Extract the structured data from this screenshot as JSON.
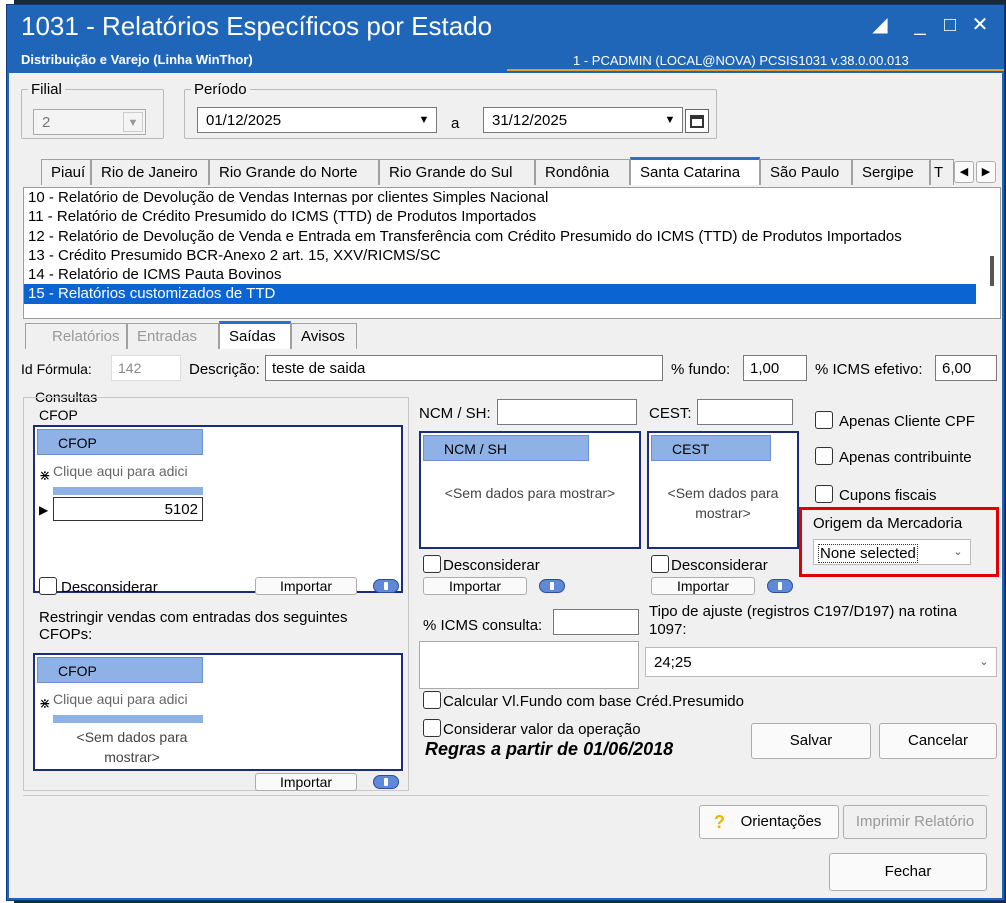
{
  "window": {
    "title": "1031 - Relatórios Específicos por Estado",
    "subtitle": "Distribuição e Varejo (Linha WinThor)",
    "sysinfo": "1 - PCADMIN (LOCAL@NOVA)   PCSIS1031  v.38.0.00.013"
  },
  "filial": {
    "legend": "Filial",
    "value": "2"
  },
  "periodo": {
    "legend": "Período",
    "start": "01/12/2025",
    "sep": "a",
    "end": "31/12/2025"
  },
  "state_tabs": [
    "Piauí",
    "Rio de Janeiro",
    "Rio Grande do Norte",
    "Rio Grande do Sul",
    "Rondônia",
    "Santa Catarina",
    "São Paulo",
    "Sergipe",
    "T"
  ],
  "selected_state_tab": "Santa Catarina",
  "reports": [
    "10 - Relatório de Devolução de Vendas Internas por clientes Simples Nacional",
    "11 - Relatório de Crédito Presumido do ICMS (TTD) de Produtos Importados",
    "12 - Relatório de Devolução de Venda e Entrada em Transferência com Crédito Presumido do ICMS (TTD) de Produtos Importados",
    "13 - Crédito Presumido BCR-Anexo 2 art. 15, XXV/RICMS/SC",
    "14 - Relatório de ICMS Pauta Bovinos",
    "15 - Relatórios customizados de TTD"
  ],
  "selected_report_index": 5,
  "sub_tabs": [
    "Relatórios",
    "Entradas",
    "Saídas",
    "Avisos"
  ],
  "form": {
    "id_label": "Id Fórmula:",
    "id_value": "142",
    "desc_label": "Descrição:",
    "desc_value": "teste de saida",
    "fundo_label": "% fundo:",
    "fundo_value": "1,00",
    "icms_label": "% ICMS efetivo:",
    "icms_value": "6,00"
  },
  "consultas": {
    "legend": "Consultas",
    "cfop_label": "CFOP",
    "grid_header": "CFOP",
    "new_row_placeholder": "Clique aqui para adici",
    "row_value": "5102",
    "desconsiderar": "Desconsiderar",
    "importar": "Importar"
  },
  "ncm": {
    "label": "NCM / SH:",
    "grid_header": "NCM / SH",
    "nodata": "<Sem dados para mostrar>",
    "desconsiderar": "Desconsiderar",
    "importar": "Importar"
  },
  "cest": {
    "label": "CEST:",
    "grid_header": "CEST",
    "nodata": "<Sem dados para mostrar>",
    "desconsiderar": "Desconsiderar",
    "importar": "Importar"
  },
  "checks": {
    "cpf": "Apenas Cliente CPF",
    "contrib": "Apenas contribuinte",
    "cupons": "Cupons fiscais"
  },
  "origem": {
    "label": "Origem da Mercadoria",
    "value": "None selected"
  },
  "restringir": {
    "label": "Restringir vendas com entradas dos seguintes CFOPs:",
    "grid_header": "CFOP",
    "new_row_placeholder": "Clique aqui para adici",
    "nodata": "<Sem dados para mostrar>",
    "importar": "Importar"
  },
  "icms_consulta_label": "% ICMS consulta:",
  "ajuste": {
    "label": "Tipo de ajuste (registros C197/D197) na rotina 1097:",
    "value": "24;25"
  },
  "calcular_label": "Calcular Vl.Fundo com base Créd.Presumido",
  "considerar_label": "Considerar valor da operação",
  "regras": "Regras a partir de 01/06/2018",
  "buttons": {
    "salvar": "Salvar",
    "cancelar": "Cancelar",
    "orientacoes": "Orientações",
    "imprimir": "Imprimir Relatório",
    "fechar": "Fechar"
  },
  "colors": {
    "title_bar": "#1f66b9",
    "selection": "#0a64d2",
    "highlight_box": "#e00000",
    "grid_header": "#8fb2e6"
  }
}
